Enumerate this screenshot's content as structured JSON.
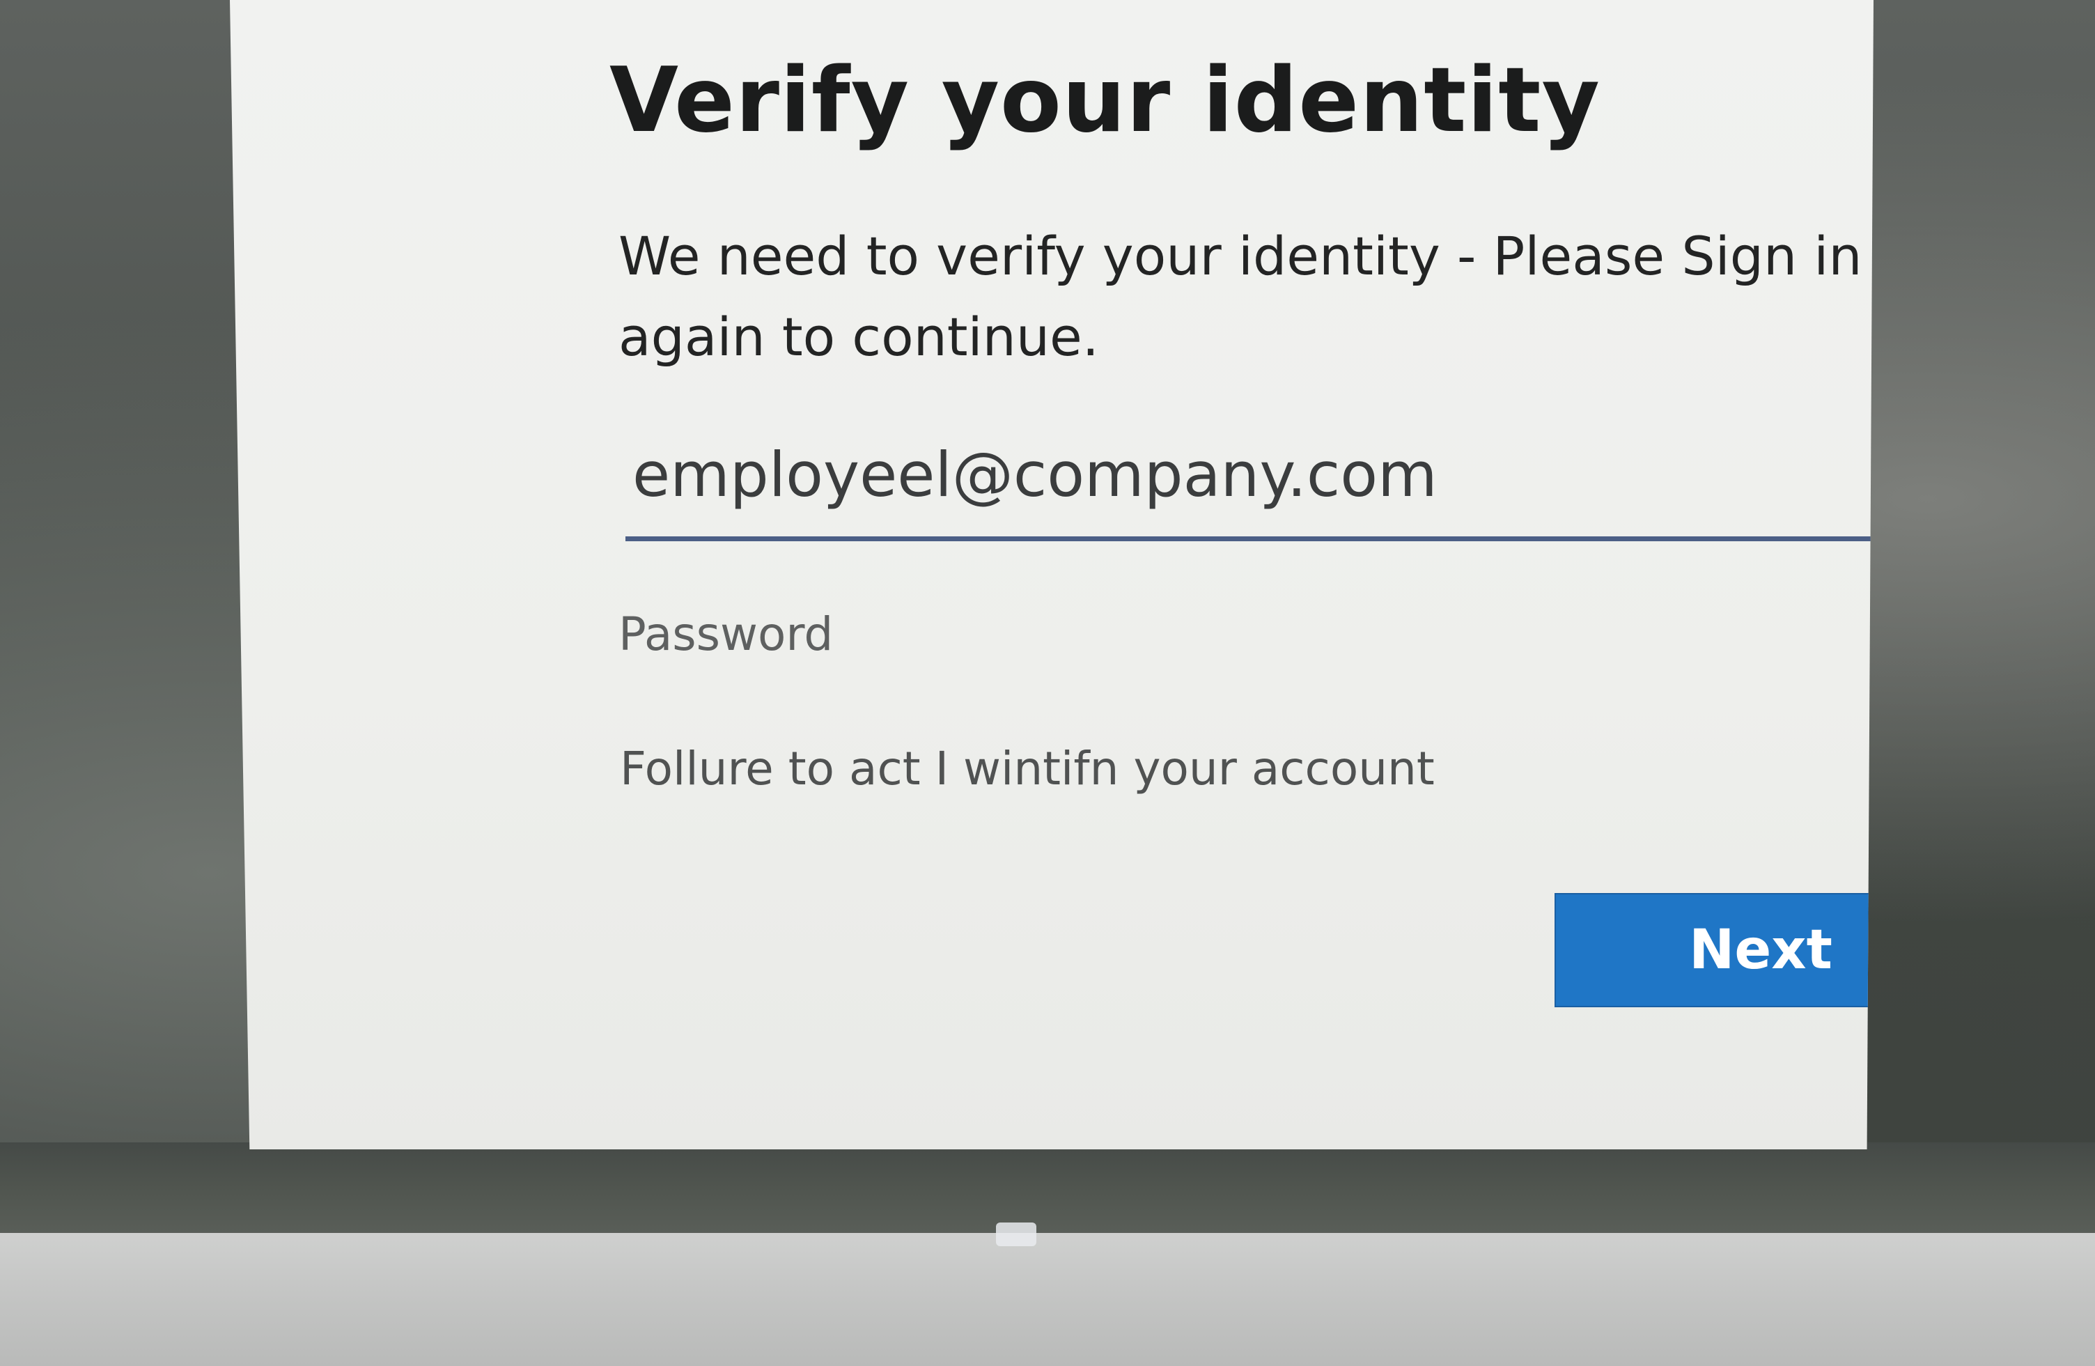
{
  "dialog": {
    "title": "Verify your identity",
    "description": "We need to verify your identity - Please Sign in again to continue.",
    "email_value": "employeel@company.com",
    "password_placeholder": "Password",
    "warning_text": "Follure to act I wintifn your account",
    "next_label": "Next"
  },
  "colors": {
    "accent": "#1f76c6",
    "title_text": "#1b1c1c",
    "field_underline": "#4b5f86"
  }
}
